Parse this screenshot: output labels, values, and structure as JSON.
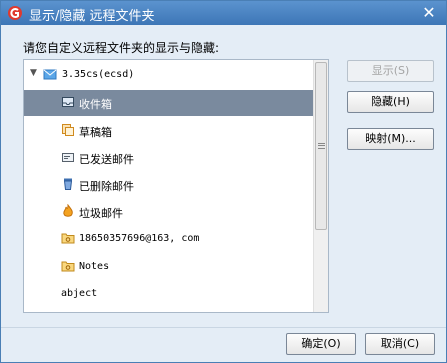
{
  "window": {
    "title": "显示/隐藏 远程文件夹"
  },
  "prompt": "请您自定义远程文件夹的显示与隐藏:",
  "account": {
    "label": "3.35cs(ecsd)",
    "expand_glyph": "▼"
  },
  "folders": [
    {
      "label": "收件箱",
      "icon": "inbox-icon",
      "selected": true
    },
    {
      "label": "草稿箱",
      "icon": "drafts-icon",
      "selected": false
    },
    {
      "label": "已发送邮件",
      "icon": "sent-icon",
      "selected": false
    },
    {
      "label": "已删除邮件",
      "icon": "trash-icon",
      "selected": false
    },
    {
      "label": "垃圾邮件",
      "icon": "junk-icon",
      "selected": false
    },
    {
      "label": "18650357696@163, com",
      "icon": "folder-icon",
      "selected": false
    },
    {
      "label": "Notes",
      "icon": "folder-icon",
      "selected": false
    },
    {
      "label": "abject",
      "icon": "",
      "selected": false
    }
  ],
  "buttons": {
    "show": "显示(S)",
    "hide": "隐藏(H)",
    "map": "映射(M)...",
    "ok": "确定(O)",
    "cancel": "取消(C)"
  },
  "colors": {
    "titlebar": "#4a86c6",
    "selected_row": "#7a8a9e",
    "dialog_bg": "#e4edf6"
  }
}
